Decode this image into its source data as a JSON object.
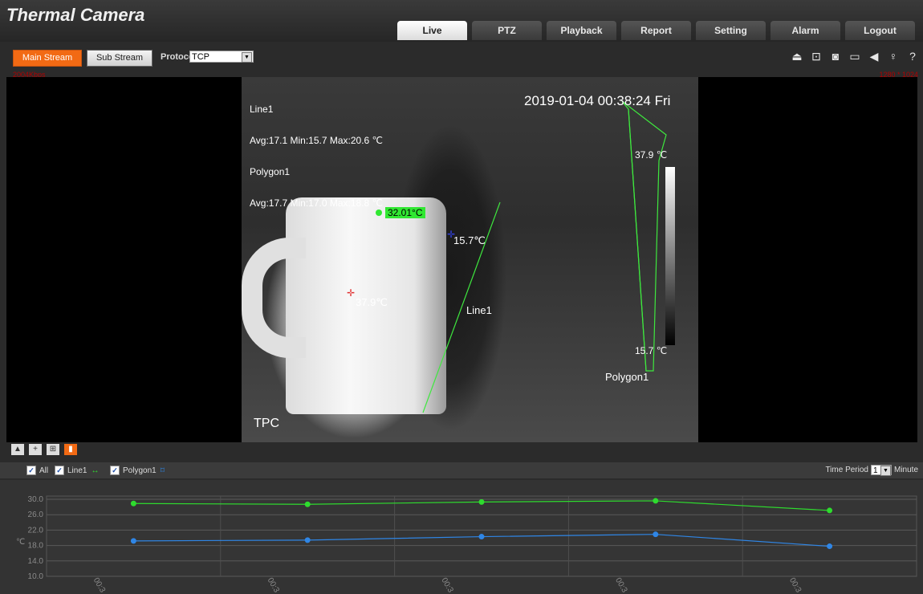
{
  "header": {
    "title": "Thermal Camera",
    "tabs": [
      {
        "label": "Live",
        "active": true
      },
      {
        "label": "PTZ",
        "active": false
      },
      {
        "label": "Playback",
        "active": false
      },
      {
        "label": "Report",
        "active": false
      },
      {
        "label": "Setting",
        "active": false
      },
      {
        "label": "Alarm",
        "active": false
      },
      {
        "label": "Logout",
        "active": false
      }
    ]
  },
  "toolbar": {
    "main_stream": "Main Stream",
    "sub_stream": "Sub Stream",
    "protocol_label": "Protocol",
    "protocol_value": "TCP",
    "icons": [
      "alarm-bell-icon",
      "zoom-icon",
      "snapshot-icon",
      "record-icon",
      "audio-icon",
      "microphone-icon",
      "help-icon"
    ]
  },
  "status": {
    "bitrate": "2004Kbps",
    "resolution": "1280 * 1024"
  },
  "video": {
    "stats_lines": [
      "Line1",
      "Avg:17.1 Min:15.7 Max:20.6 ℃",
      "Polygon1",
      "Avg:17.7 Min:17.0 Max:18.8 ℃"
    ],
    "timestamp": "2019-01-04 00:38:24 Fri",
    "osd_label": "TPC",
    "cup_temp": "32.01°C",
    "cold_spot": "15.7℃",
    "hot_spot": "37.9℃",
    "line_label": "Line1",
    "polygon_label": "Polygon1",
    "scale_max": "37.9 ℃",
    "scale_min": "15.7 ℃"
  },
  "legend": {
    "all": "All",
    "line1": "Line1",
    "polygon1": "Polygon1",
    "time_period_label": "Time Period",
    "time_period_value": "1",
    "time_unit": "Minute"
  },
  "chart_data": {
    "type": "line",
    "ylabel": "℃",
    "ylim": [
      10,
      30
    ],
    "yticks": [
      "30.0",
      "26.0",
      "22.0",
      "18.0",
      "14.0",
      "10.0"
    ],
    "xticks": [
      "00:3",
      "00:3",
      "00:3",
      "00:3",
      "00:3"
    ],
    "series": [
      {
        "name": "Line1",
        "color": "#2edc2e",
        "values": [
          28.9,
          28.7,
          29.3,
          29.6,
          27.1
        ]
      },
      {
        "name": "Polygon1",
        "color": "#2f86e6",
        "values": [
          19.2,
          19.4,
          20.3,
          20.9,
          17.8
        ]
      }
    ],
    "grid": true
  }
}
